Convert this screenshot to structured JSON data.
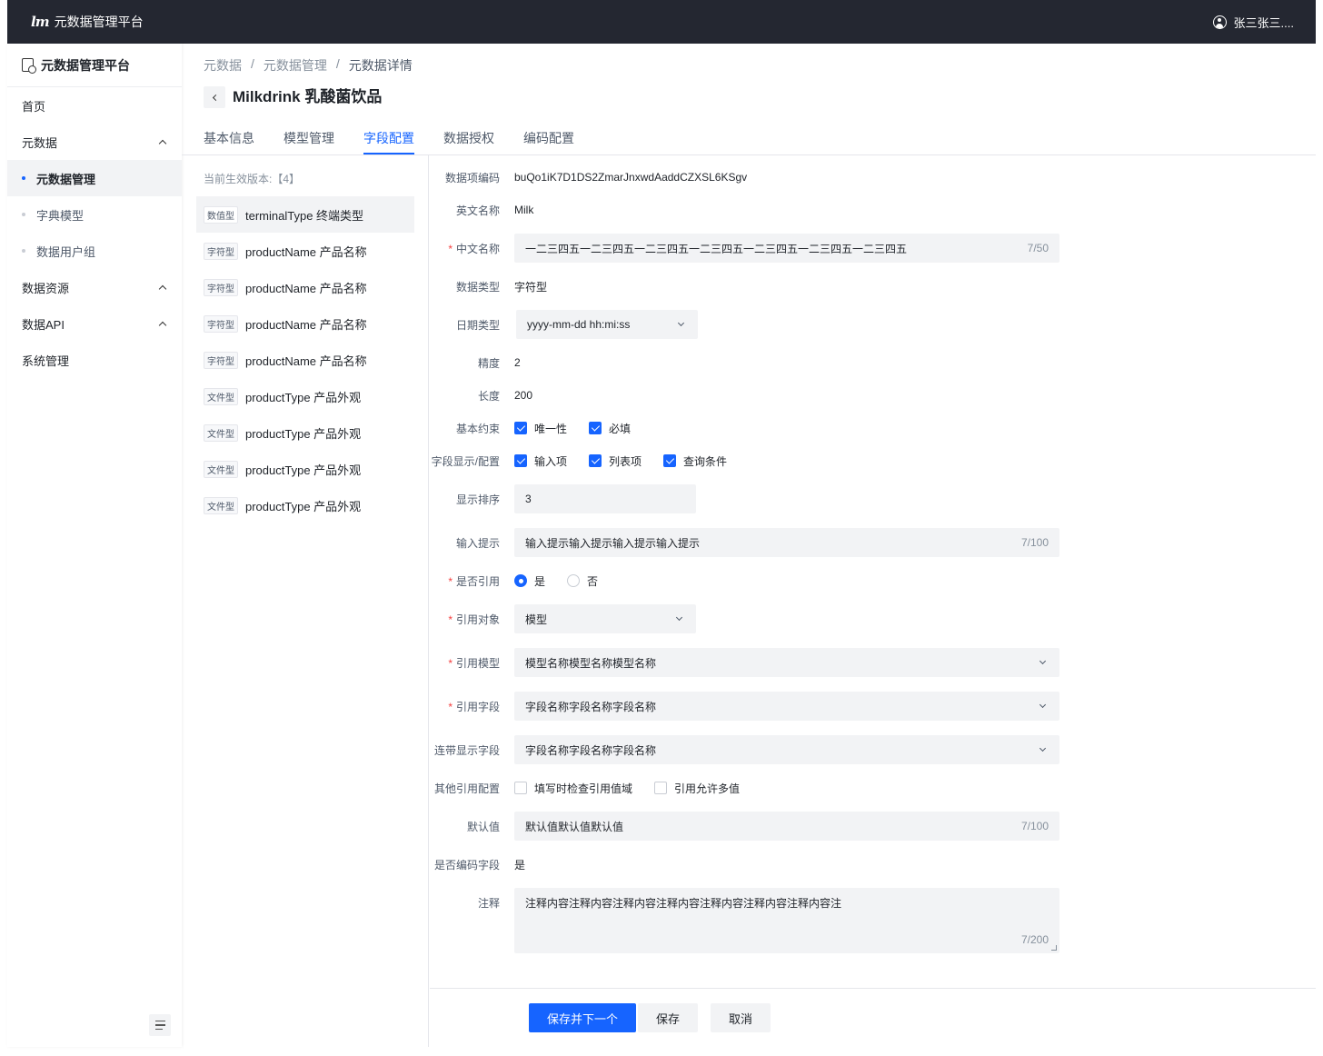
{
  "topbar": {
    "brand_logo": "lm",
    "brand": "元数据管理平台",
    "user": "张三张三...."
  },
  "sidebar": {
    "title": "元数据管理平台",
    "items": [
      {
        "label": "首页"
      },
      {
        "label": "元数据"
      },
      {
        "label": "元数据管理"
      },
      {
        "label": "字典模型"
      },
      {
        "label": "数据用户组"
      },
      {
        "label": "数据资源"
      },
      {
        "label": "数据API"
      },
      {
        "label": "系统管理"
      }
    ]
  },
  "breadcrumb": [
    "元数据",
    "/",
    "元数据管理",
    "/",
    "元数据详情"
  ],
  "page_title": "Milkdrink 乳酸菌饮品",
  "tabs": [
    "基本信息",
    "模型管理",
    "字段配置",
    "数据授权",
    "编码配置"
  ],
  "field_list": {
    "version": "当前生效版本:【4】",
    "items": [
      {
        "tag": "数值型",
        "name": "terminalType  终端类型"
      },
      {
        "tag": "字符型",
        "name": "productName  产品名称"
      },
      {
        "tag": "字符型",
        "name": "productName  产品名称"
      },
      {
        "tag": "字符型",
        "name": "productName  产品名称"
      },
      {
        "tag": "字符型",
        "name": "productName  产品名称"
      },
      {
        "tag": "文件型",
        "name": "productType  产品外观"
      },
      {
        "tag": "文件型",
        "name": "productType  产品外观"
      },
      {
        "tag": "文件型",
        "name": "productType  产品外观"
      },
      {
        "tag": "文件型",
        "name": "productType  产品外观"
      }
    ]
  },
  "form": {
    "code": {
      "label": "数据项编码",
      "value": "buQo1iK7D1DS2ZmarJnxwdAaddCZXSL6KSgv"
    },
    "en_name": {
      "label": "英文名称",
      "value": "Milk"
    },
    "cn_name": {
      "label": "中文名称",
      "value": "一二三四五一二三四五一二三四五一二三四五一二三四五一二三四五一二三四五",
      "count": "7/50"
    },
    "data_type": {
      "label": "数据类型",
      "value": "字符型"
    },
    "date_type": {
      "label": "日期类型",
      "value": "yyyy-mm-dd hh:mi:ss"
    },
    "precision": {
      "label": "精度",
      "value": "2"
    },
    "length": {
      "label": "长度",
      "value": "200"
    },
    "constraint": {
      "label": "基本约束",
      "options": [
        "唯一性",
        "必填"
      ]
    },
    "display": {
      "label": "字段显示/配置",
      "options": [
        "输入项",
        "列表项",
        "查询条件"
      ]
    },
    "order": {
      "label": "显示排序",
      "value": "3"
    },
    "hint": {
      "label": "输入提示",
      "value": "输入提示输入提示输入提示输入提示",
      "count": "7/100"
    },
    "is_ref": {
      "label": "是否引用",
      "options": [
        "是",
        "否"
      ]
    },
    "ref_target": {
      "label": "引用对象",
      "value": "模型"
    },
    "ref_model": {
      "label": "引用模型",
      "value": "模型名称模型名称模型名称"
    },
    "ref_field": {
      "label": "引用字段",
      "value": "字段名称字段名称字段名称"
    },
    "linked_field": {
      "label": "连带显示字段",
      "value": "字段名称字段名称字段名称"
    },
    "other_ref": {
      "label": "其他引用配置",
      "options": [
        "填写时检查引用值域",
        "引用允许多值"
      ]
    },
    "default": {
      "label": "默认值",
      "value": "默认值默认值默认值",
      "count": "7/100"
    },
    "is_code": {
      "label": "是否编码字段",
      "value": "是"
    },
    "remark": {
      "label": "注释",
      "value": "注释内容注释内容注释内容注释内容注释内容注释内容注释内容注",
      "count": "7/200"
    }
  },
  "footer": {
    "save_next": "保存并下一个",
    "save": "保存",
    "cancel": "取消"
  },
  "colors": {
    "accent": "#1664ff",
    "topbar": "#242731",
    "required": "#f53f3f"
  }
}
